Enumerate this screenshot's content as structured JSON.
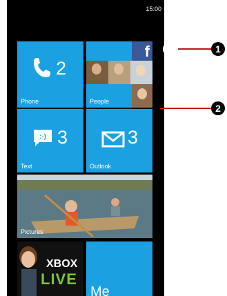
{
  "status_bar": {
    "time": "15:00"
  },
  "tiles": {
    "phone": {
      "label": "Phone",
      "count": "2"
    },
    "people": {
      "label": "People",
      "badge": "f"
    },
    "text": {
      "label": "Text",
      "count": "3"
    },
    "outlook": {
      "label": "Outlook",
      "count": "3"
    },
    "pictures": {
      "label": "Pictures"
    },
    "xbox": {
      "line1": "XBOX",
      "line2": "LIVE"
    },
    "me": {
      "label": "Me"
    }
  },
  "callouts": [
    "1",
    "2"
  ],
  "icons": {
    "arrow": "arrow-right-circle-icon",
    "phone": "phone-icon",
    "text": "smiley-message-icon",
    "outlook": "envelope-icon",
    "facebook": "facebook-icon"
  },
  "colors": {
    "tile": "#1ba1e2",
    "callout_line": "#c1121f",
    "facebook": "#3b5998"
  }
}
